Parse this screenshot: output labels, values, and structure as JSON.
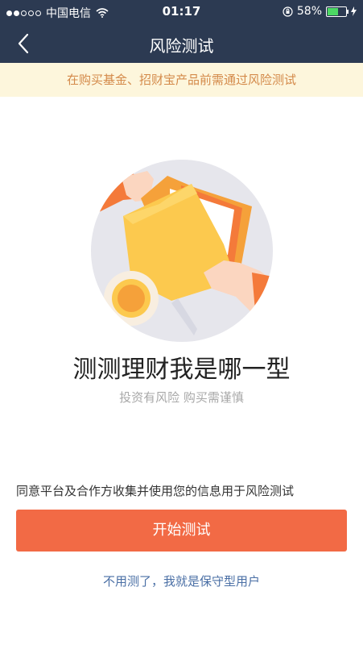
{
  "status_bar": {
    "carrier": "中国电信",
    "time": "01:17",
    "battery_percent": "58%",
    "battery_level": 0.58,
    "colors": {
      "bar": "#2c3a52",
      "battery": "#4cd964"
    }
  },
  "nav": {
    "title": "风险测试",
    "back_icon": "chevron-left-icon"
  },
  "notice": {
    "text": "在购买基金、招财宝产品前需通过风险测试",
    "colors": {
      "bg": "#fdf6dc",
      "text": "#d48a4a"
    }
  },
  "main": {
    "title": "测测理财我是哪一型",
    "subtitle": "投资有风险 购买需谨慎",
    "agreement": "同意平台及合作方收集并使用您的信息用于风险测试",
    "start_button": "开始测试",
    "skip_link": "不用测了，我就是保守型用户",
    "colors": {
      "button": "#f26a45",
      "link": "#4a6fa5"
    }
  }
}
